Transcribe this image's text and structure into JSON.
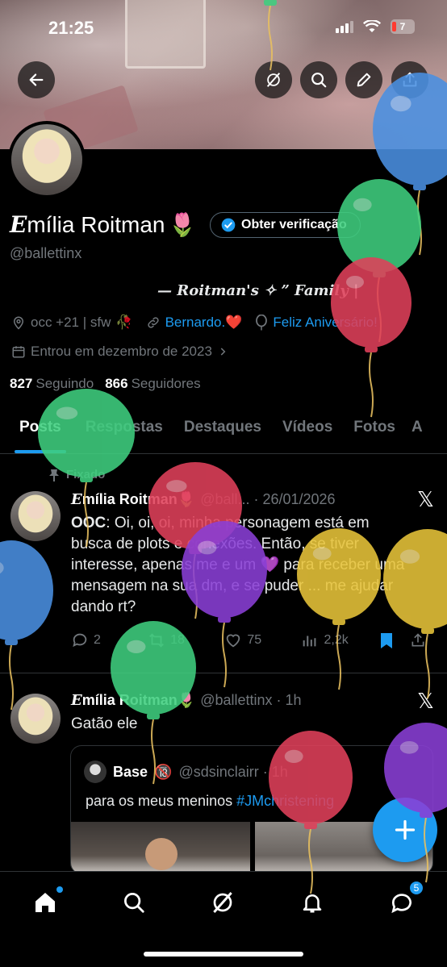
{
  "status_bar": {
    "time": "21:25",
    "battery": "7"
  },
  "profile": {
    "display_name_first": "E",
    "display_name_rest": "mília Roitman",
    "name_emoji": "🌷",
    "handle": "@ballettinx",
    "verify_label": "Obter verificação",
    "bio": "— Roitman's ✧ ” Family |",
    "location": "occ +21 | sfw",
    "location_emoji": "🥀",
    "link1": "Bernardo.",
    "link1_emoji": "❤️",
    "birthday": "Feliz Aniversário!",
    "joined": "Entrou em dezembro de 2023",
    "following_count": "827",
    "following_label": "Seguindo",
    "followers_count": "866",
    "followers_label": "Seguidores"
  },
  "tabs": [
    "Posts",
    "Respostas",
    "Destaques",
    "Vídeos",
    "Fotos",
    "A"
  ],
  "posts": [
    {
      "pinned_label": "Fixado",
      "name_first": "E",
      "name_rest": "mília Roitman",
      "emoji": "🌷",
      "meta": "@ball... · 26/01/2026",
      "text_prefix": "OOC",
      "text": ": Oi, oi, oi, minha personagem está em busca de plots e conexões. Então, se tiver interesse, apenas me e um 💜 para receber uma mensagem na sua dm, e se puder ... me ajudar dando rt?",
      "replies": "2",
      "reposts": "18",
      "likes": "75",
      "views": "2,2k"
    },
    {
      "name_first": "E",
      "name_rest": "mília Roitman",
      "emoji": "🌷",
      "meta": "@ballettinx · 1h",
      "text": "Gatão ele",
      "quote": {
        "name": "Base",
        "emoji": "🔞",
        "meta": "@sdsinclairr · 1h",
        "text": "para os meus meninos",
        "hashtag": "#JMchristening"
      }
    }
  ],
  "nav": {
    "messages_badge": "5"
  },
  "colors": {
    "accent": "#1d9bf0",
    "background": "#000000",
    "muted": "#71767b",
    "balloon_blue": "#4a90e2",
    "balloon_green": "#3fcf7f",
    "balloon_red": "#e0405a",
    "balloon_purple": "#8a3fd6",
    "balloon_yellow": "#e8c43a"
  }
}
